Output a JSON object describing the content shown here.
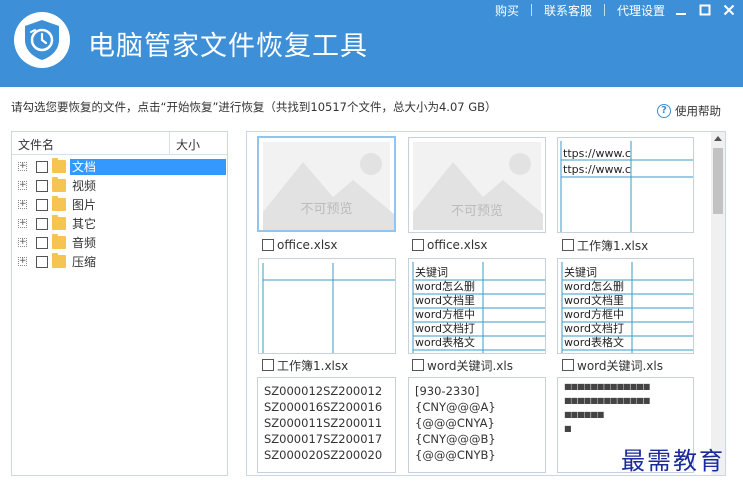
{
  "header": {
    "title": "电脑管家文件恢复工具",
    "links": [
      "购买",
      "联系客服",
      "代理设置"
    ],
    "bg_color": "#3d8fd8"
  },
  "info": {
    "text": "请勾选您要恢复的文件，点击“开始恢复”进行恢复（共找到10517个文件，总大小为4.07 GB）",
    "help_label": "使用帮助"
  },
  "tree": {
    "col_name": "文件名",
    "col_size": "大小",
    "items": [
      {
        "label": "文档",
        "selected": true
      },
      {
        "label": "视频",
        "selected": false
      },
      {
        "label": "图片",
        "selected": false
      },
      {
        "label": "其它",
        "selected": false
      },
      {
        "label": "音频",
        "selected": false
      },
      {
        "label": "压缩",
        "selected": false
      }
    ]
  },
  "files": [
    {
      "name": "office.xlsx",
      "preview": "不可预览"
    },
    {
      "name": "office.xlsx",
      "preview": "不可预览"
    },
    {
      "name": "工作簿1.xlsx",
      "cells": [
        "ttps://www.c",
        "ttps://www.c"
      ]
    },
    {
      "name": "工作簿1.xlsx"
    },
    {
      "name": "word关键词.xls",
      "cells": [
        "关键词",
        "word怎么删",
        "word文档里",
        "word方框中",
        "word文档打",
        "word表格文"
      ]
    },
    {
      "name": "word关键词.xls",
      "cells": [
        "关键词",
        "word怎么删",
        "word文档里",
        "word方框中",
        "word文档打",
        "word表格文"
      ]
    },
    {
      "lines": [
        "SZ000012SZ200012",
        "SZ000016SZ200016",
        "SZ000011SZ200011",
        "SZ000017SZ200017",
        "SZ000020SZ200020"
      ]
    },
    {
      "lines": [
        "[930-2330]",
        "{CNY@@@A}",
        "{@@@CNYA}",
        "{CNY@@@B}",
        "{@@@CNYB}"
      ]
    },
    {
      "lines": [
        "■■■■■■■■■■■■■",
        "■■■■■■■■■■■■■",
        "■■■■■■",
        "■"
      ]
    }
  ],
  "watermark": "最需教育"
}
